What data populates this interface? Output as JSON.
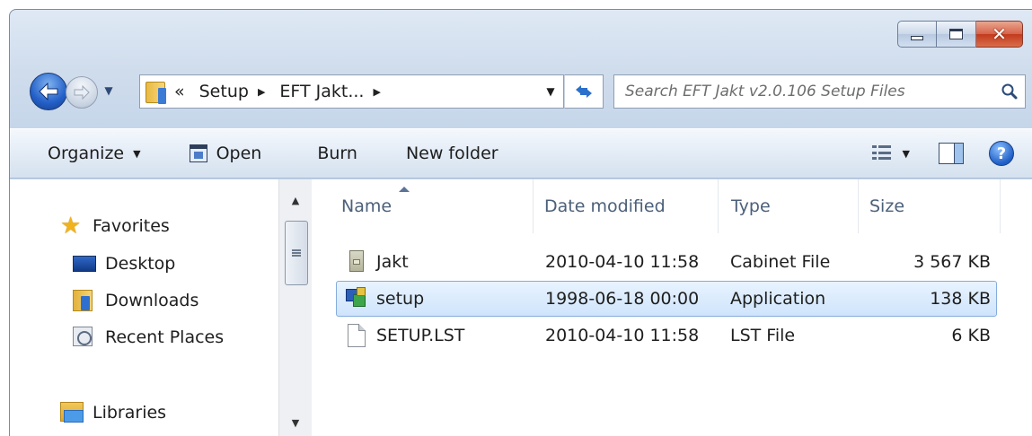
{
  "window": {
    "close_glyph": "✕"
  },
  "address": {
    "overflow": "«",
    "segments": [
      "Setup",
      "EFT Jakt..."
    ]
  },
  "search": {
    "placeholder": "Search EFT Jakt v2.0.106 Setup Files"
  },
  "toolbar": {
    "organize": "Organize",
    "open": "Open",
    "burn": "Burn",
    "new_folder": "New folder",
    "help": "?"
  },
  "nav": {
    "favorites": "Favorites",
    "desktop": "Desktop",
    "downloads": "Downloads",
    "recent_places": "Recent Places",
    "libraries": "Libraries"
  },
  "columns": {
    "name": "Name",
    "date": "Date modified",
    "type": "Type",
    "size": "Size"
  },
  "files": [
    {
      "name": "Jakt",
      "date": "2010-04-10 11:58",
      "type": "Cabinet File",
      "size": "3 567 KB"
    },
    {
      "name": "setup",
      "date": "1998-06-18 00:00",
      "type": "Application",
      "size": "138 KB"
    },
    {
      "name": "SETUP.LST",
      "date": "2010-04-10 11:58",
      "type": "LST File",
      "size": "6 KB"
    }
  ],
  "colors": {
    "selection": "#cfe4fb",
    "selection_border": "#84acdd",
    "header_text": "#4c607a"
  }
}
